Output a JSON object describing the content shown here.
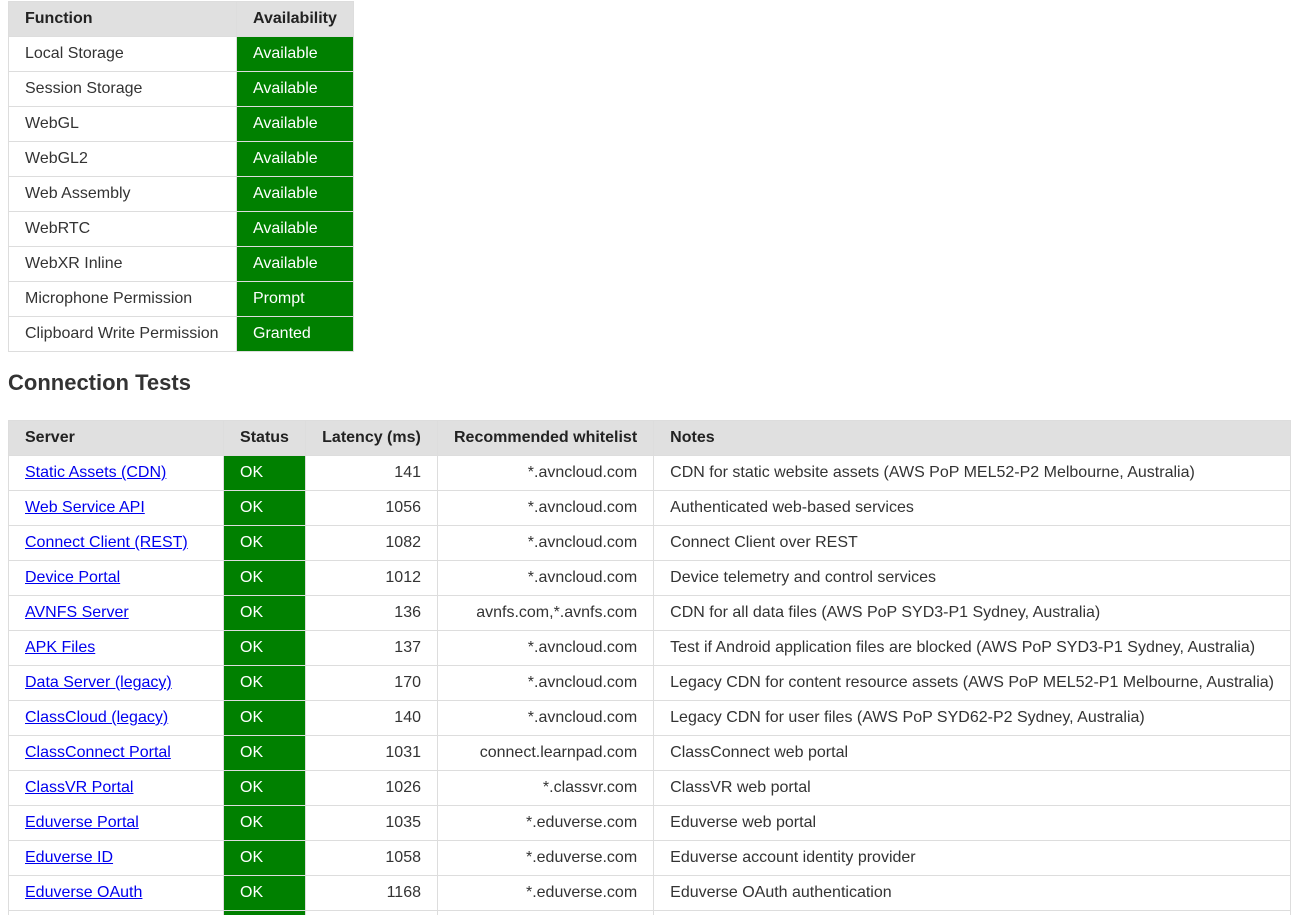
{
  "function_table": {
    "headers": {
      "function": "Function",
      "availability": "Availability"
    },
    "rows": [
      {
        "function": "Local Storage",
        "availability": "Available"
      },
      {
        "function": "Session Storage",
        "availability": "Available"
      },
      {
        "function": "WebGL",
        "availability": "Available"
      },
      {
        "function": "WebGL2",
        "availability": "Available"
      },
      {
        "function": "Web Assembly",
        "availability": "Available"
      },
      {
        "function": "WebRTC",
        "availability": "Available"
      },
      {
        "function": "WebXR Inline",
        "availability": "Available"
      },
      {
        "function": "Microphone Permission",
        "availability": "Prompt"
      },
      {
        "function": "Clipboard Write Permission",
        "availability": "Granted"
      }
    ]
  },
  "connection_section": {
    "title": "Connection Tests",
    "headers": {
      "server": "Server",
      "status": "Status",
      "latency": "Latency (ms)",
      "whitelist": "Recommended whitelist",
      "notes": "Notes"
    },
    "rows": [
      {
        "server": "Static Assets (CDN)",
        "status": "OK",
        "latency": "141",
        "whitelist": "*.avncloud.com",
        "notes": "CDN for static website assets (AWS PoP MEL52-P2 Melbourne, Australia)"
      },
      {
        "server": "Web Service API",
        "status": "OK",
        "latency": "1056",
        "whitelist": "*.avncloud.com",
        "notes": "Authenticated web-based services"
      },
      {
        "server": "Connect Client (REST)",
        "status": "OK",
        "latency": "1082",
        "whitelist": "*.avncloud.com",
        "notes": "Connect Client over REST"
      },
      {
        "server": "Device Portal",
        "status": "OK",
        "latency": "1012",
        "whitelist": "*.avncloud.com",
        "notes": "Device telemetry and control services"
      },
      {
        "server": "AVNFS Server",
        "status": "OK",
        "latency": "136",
        "whitelist": "avnfs.com,*.avnfs.com",
        "notes": "CDN for all data files (AWS PoP SYD3-P1 Sydney, Australia)"
      },
      {
        "server": "APK Files",
        "status": "OK",
        "latency": "137",
        "whitelist": "*.avncloud.com",
        "notes": "Test if Android application files are blocked (AWS PoP SYD3-P1 Sydney, Australia)"
      },
      {
        "server": "Data Server (legacy)",
        "status": "OK",
        "latency": "170",
        "whitelist": "*.avncloud.com",
        "notes": "Legacy CDN for content resource assets (AWS PoP MEL52-P1 Melbourne, Australia)"
      },
      {
        "server": "ClassCloud (legacy)",
        "status": "OK",
        "latency": "140",
        "whitelist": "*.avncloud.com",
        "notes": "Legacy CDN for user files (AWS PoP SYD62-P2 Sydney, Australia)"
      },
      {
        "server": "ClassConnect Portal",
        "status": "OK",
        "latency": "1031",
        "whitelist": "connect.learnpad.com",
        "notes": "ClassConnect web portal"
      },
      {
        "server": "ClassVR Portal",
        "status": "OK",
        "latency": "1026",
        "whitelist": "*.classvr.com",
        "notes": "ClassVR web portal"
      },
      {
        "server": "Eduverse Portal",
        "status": "OK",
        "latency": "1035",
        "whitelist": "*.eduverse.com",
        "notes": "Eduverse web portal"
      },
      {
        "server": "Eduverse ID",
        "status": "OK",
        "latency": "1058",
        "whitelist": "*.eduverse.com",
        "notes": "Eduverse account identity provider"
      },
      {
        "server": "Eduverse OAuth",
        "status": "OK",
        "latency": "1168",
        "whitelist": "*.eduverse.com",
        "notes": "Eduverse OAuth authentication"
      }
    ]
  },
  "colors": {
    "status_green": "#008000",
    "header_bg": "#e0e0e0",
    "link": "#0000ee"
  }
}
